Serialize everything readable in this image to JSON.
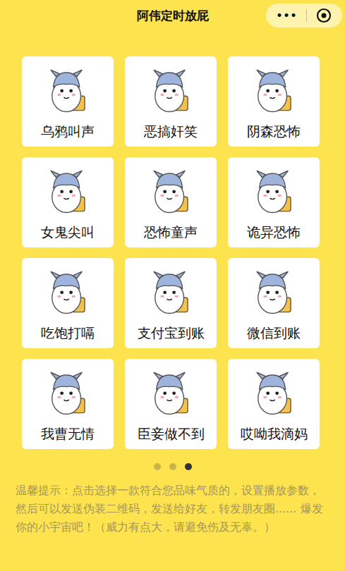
{
  "window": {
    "title": "阿伟定时放屁"
  },
  "capsule": {
    "menu": "•••"
  },
  "sounds": [
    {
      "label": "乌鸦叫声"
    },
    {
      "label": "恶搞奸笑"
    },
    {
      "label": "阴森恐怖"
    },
    {
      "label": "女鬼尖叫"
    },
    {
      "label": "恐怖童声"
    },
    {
      "label": "诡异恐怖"
    },
    {
      "label": "吃饱打嗝"
    },
    {
      "label": "支付宝到账"
    },
    {
      "label": "微信到账"
    },
    {
      "label": "我曹无情"
    },
    {
      "label": "臣妾做不到"
    },
    {
      "label": "哎呦我滴妈"
    }
  ],
  "pagination": [
    {
      "selected": false
    },
    {
      "selected": false
    },
    {
      "selected": true
    }
  ],
  "tip": "温馨提示：点击选择一款符合您品味气质的，设置播放参数，然后可以发送伪装二维码，发送给好友，转发朋友圈...... 爆发你的小宇宙吧！（威力有点大，请避免伤及无辜。）"
}
